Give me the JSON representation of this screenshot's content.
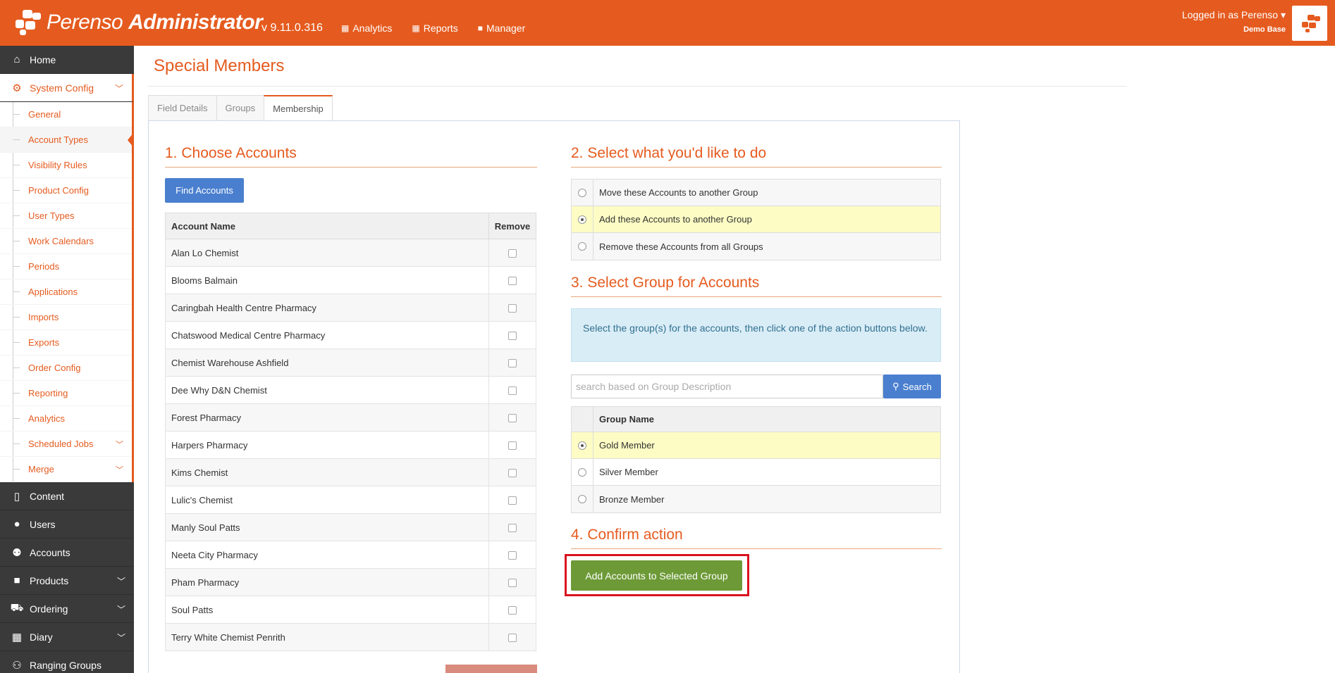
{
  "header": {
    "brand_light": "Perenso",
    "brand_bold": "Administrator",
    "version": "v 9.11.0.316",
    "nav": [
      {
        "label": "Analytics",
        "icon": "chart-icon"
      },
      {
        "label": "Reports",
        "icon": "table-icon"
      },
      {
        "label": "Manager",
        "icon": "briefcase-icon"
      }
    ],
    "user": "Logged in as Perenso ▾",
    "base": "Demo Base"
  },
  "sidebar": {
    "home": "Home",
    "system_config": "System Config",
    "sub_items": [
      "General",
      "Account Types",
      "Visibility Rules",
      "Product Config",
      "User Types",
      "Work Calendars",
      "Periods",
      "Applications",
      "Imports",
      "Exports",
      "Order Config",
      "Reporting",
      "Analytics",
      "Scheduled Jobs",
      "Merge"
    ],
    "content": "Content",
    "users": "Users",
    "accounts": "Accounts",
    "products": "Products",
    "ordering": "Ordering",
    "diary": "Diary",
    "ranging_groups": "Ranging Groups"
  },
  "page": {
    "title": "Special Members",
    "tabs": [
      "Field Details",
      "Groups",
      "Membership"
    ],
    "active_tab": "Membership"
  },
  "step1": {
    "heading": "1. Choose Accounts",
    "find_button": "Find Accounts",
    "col_name": "Account Name",
    "col_remove": "Remove",
    "accounts": [
      "Alan Lo Chemist",
      "Blooms Balmain",
      "Caringbah Health Centre Pharmacy",
      "Chatswood Medical Centre Pharmacy",
      "Chemist Warehouse Ashfield",
      "Dee Why D&N Chemist",
      "Forest Pharmacy",
      "Harpers Pharmacy",
      "Kims Chemist",
      "Lulic's Chemist",
      "Manly Soul Patts",
      "Neeta City Pharmacy",
      "Pham Pharmacy",
      "Soul Patts",
      "Terry White Chemist Penrith"
    ]
  },
  "step2": {
    "heading": "2. Select what you'd like to do",
    "options": [
      "Move these Accounts to another Group",
      "Add these Accounts to another Group",
      "Remove these Accounts from all Groups"
    ],
    "selected_index": 1
  },
  "step3": {
    "heading": "3. Select Group for Accounts",
    "info": "Select the group(s) for the accounts, then click one of the action buttons below.",
    "search_placeholder": "search based on Group Description",
    "search_button": "Search",
    "col_group": "Group Name",
    "groups": [
      "Gold Member",
      "Silver Member",
      "Bronze Member"
    ],
    "selected_index": 0
  },
  "step4": {
    "heading": "4. Confirm action",
    "button": "Add Accounts to Selected Group"
  },
  "colors": {
    "brand": "#e55b1f",
    "confirm": "#6d9a37",
    "button_blue": "#4a7fcf",
    "highlight": "#d9121e"
  }
}
